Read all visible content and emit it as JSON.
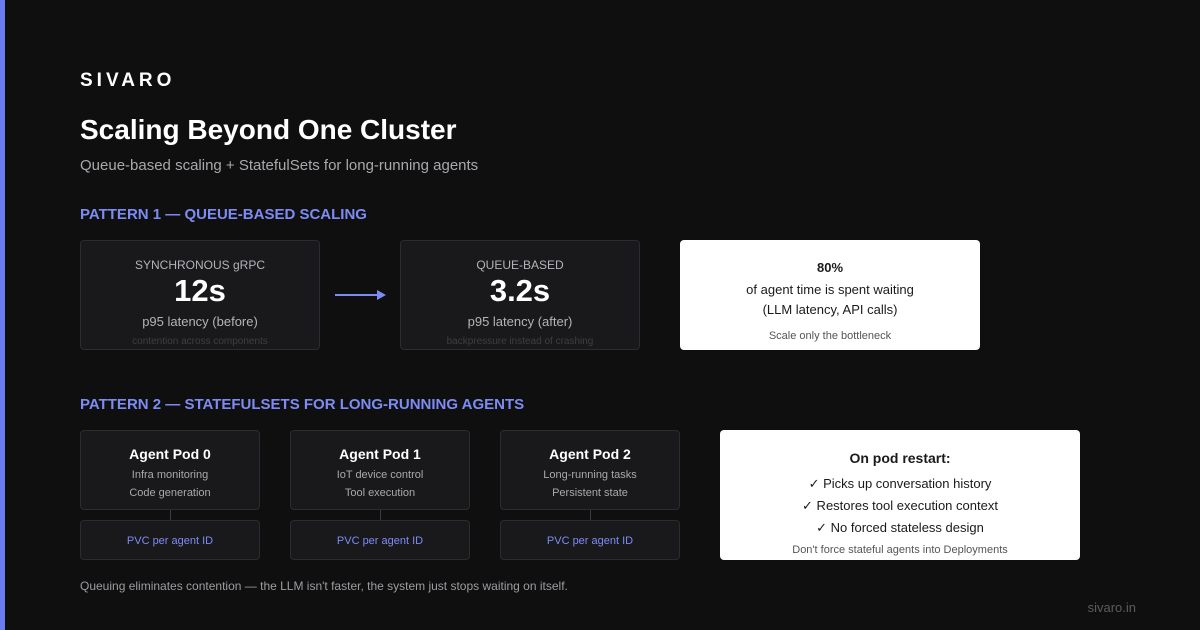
{
  "brand": "SIVARO",
  "title": "Scaling Beyond One Cluster",
  "subtitle": "Queue-based scaling + StatefulSets for long-running agents",
  "colors": {
    "accent": "#6b7cf0",
    "heading": "#7d8cf5",
    "background": "#0f0f10"
  },
  "pattern1": {
    "heading": "PATTERN 1 — QUEUE-BASED SCALING",
    "before": {
      "label": "SYNCHRONOUS gRPC",
      "value": "12s",
      "caption": "p95 latency (before)",
      "note": "contention across components"
    },
    "after": {
      "label": "QUEUE-BASED",
      "value": "3.2s",
      "caption": "p95 latency (after)",
      "note": "backpressure instead of crashing"
    },
    "arrow_icon": "arrow-right-icon",
    "stat": {
      "value": "80%",
      "line1": "of agent time is spent waiting",
      "line2": "(LLM latency, API calls)",
      "foot": "Scale only the bottleneck"
    }
  },
  "pattern2": {
    "heading": "PATTERN 2 — STATEFULSETS FOR LONG-RUNNING AGENTS",
    "pods": [
      {
        "title": "Agent Pod 0",
        "line1": "Infra monitoring",
        "line2": "Code generation",
        "pvc": "PVC per agent ID"
      },
      {
        "title": "Agent Pod 1",
        "line1": "IoT device control",
        "line2": "Tool execution",
        "pvc": "PVC per agent ID"
      },
      {
        "title": "Agent Pod 2",
        "line1": "Long-running tasks",
        "line2": "Persistent state",
        "pvc": "PVC per agent ID"
      }
    ],
    "restart": {
      "title": "On pod restart:",
      "items": [
        "✓ Picks up conversation history",
        "✓ Restores tool execution context",
        "✓ No forced stateless design"
      ],
      "foot": "Don't force stateful agents into Deployments"
    }
  },
  "footer_note": "Queuing eliminates contention — the LLM isn't faster, the system just stops waiting on itself.",
  "site": "sivaro.in"
}
